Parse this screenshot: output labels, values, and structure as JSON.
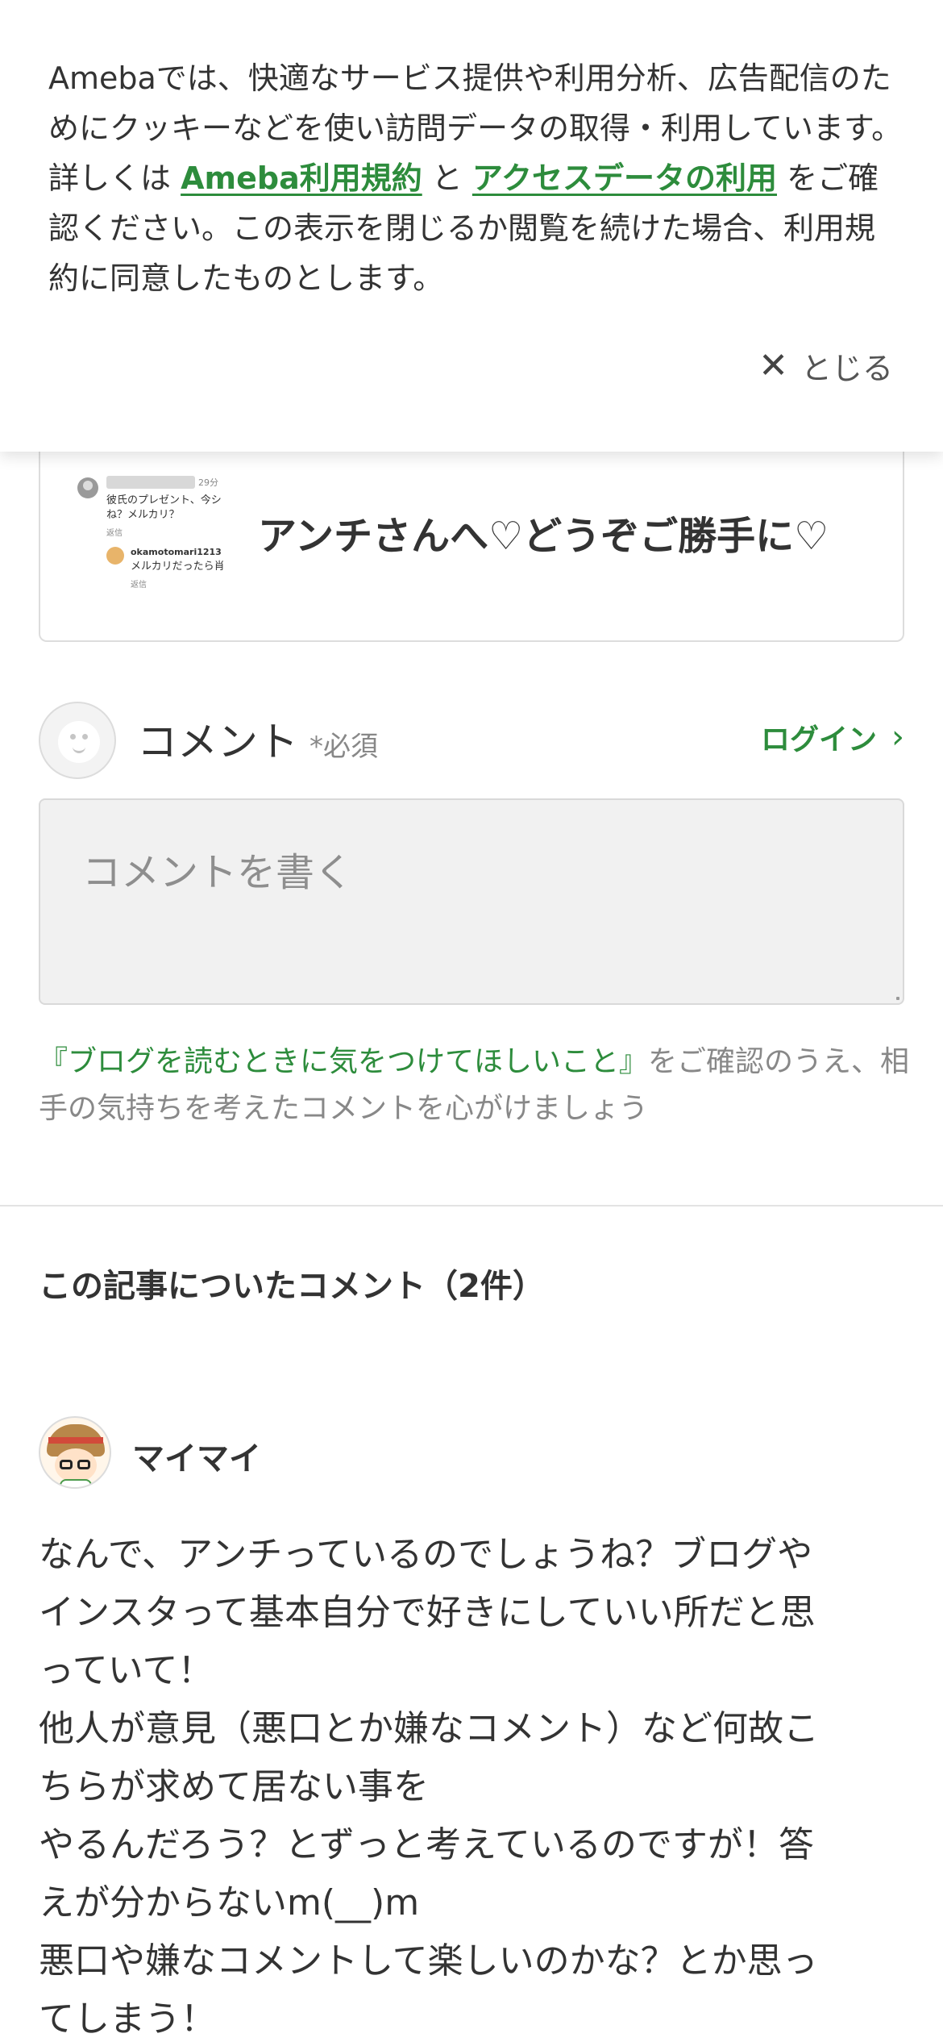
{
  "cookie_banner": {
    "text_before": "Amebaでは、快適なサービス提供や利用分析、広告配信のためにクッキーなどを使い訪問データの取得・利用しています。詳しくは ",
    "link_terms": "Ameba利用規約",
    "text_between": " と ",
    "link_access": "アクセスデータの利用",
    "text_after": " をご確認ください。この表示を閉じるか閲覧を続けた場合、利用規約に同意したものとします。",
    "close_label": "とじる",
    "close_icon": "close-icon"
  },
  "article_card": {
    "title": "アンチさんへ♡どうぞご勝手に♡",
    "thumbnail": {
      "time": "29分",
      "line1": "彼氏のプレゼント、今シ",
      "line2": "ね？メルカリ？",
      "reply1": "返信",
      "username": "okamotomari1213",
      "reply_text": "メルカリだったら肖",
      "reply2": "返信"
    }
  },
  "comment_form": {
    "label": "コメント",
    "required": "*必須",
    "login_label": "ログイン",
    "login_icon": "chevron-right-icon",
    "placeholder": "コメントを書く",
    "guideline_link": "『ブログを読むときに気をつけてほしいこと』",
    "guideline_text": "をご確認のうえ、相手の気持ちを考えたコメントを心がけましょう"
  },
  "comments": {
    "heading": "この記事についたコメント（2件）",
    "items": [
      {
        "name": "マイマイ",
        "lines": [
          "なんで、アンチっているのでしょうね？ブログや",
          "インスタって基本自分で好きにしていい所だと思",
          "っていて！",
          "他人が意見（悪口とか嫌なコメント）など何故こ",
          "ちらが求めて居ない事を",
          "やるんだろう？とずっと考えているのですが！答",
          "えが分からないm(__)m",
          "悪口や嫌なコメントして楽しいのかな？とか思っ",
          "てしまう！"
        ]
      }
    ]
  },
  "colors": {
    "accent_green": "#2d8c3c",
    "text_primary": "#333333",
    "text_muted": "#888888"
  }
}
